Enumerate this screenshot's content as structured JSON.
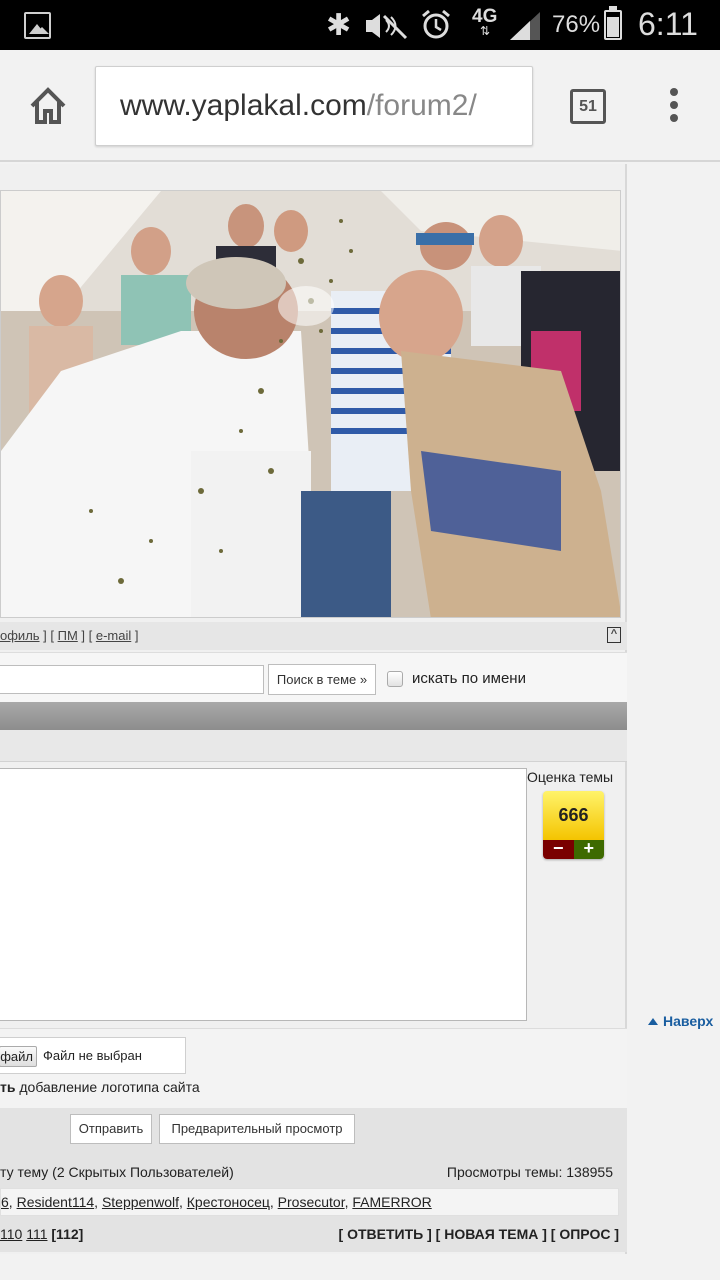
{
  "status_bar": {
    "battery": "76%",
    "time": "6:11",
    "network": "4G",
    "icons": [
      "gallery-icon",
      "bluetooth-icon",
      "mute-icon",
      "alarm-icon",
      "signal-icon",
      "battery-icon"
    ]
  },
  "browser": {
    "url_host": "www.yaplakal.com",
    "url_path": "/forum2/",
    "tab_count": "51"
  },
  "post": {
    "links": {
      "profile": "офиль",
      "pm": "ПМ",
      "email": "e-mail",
      "sep1": " ] [ ",
      "sep2": " ] [ ",
      "end": " ]"
    },
    "top_link": "^"
  },
  "search": {
    "button": "Поиск в теме »",
    "by_name_label": "искать по имени"
  },
  "rating": {
    "label": "Оценка темы",
    "value": "666",
    "minus": "−",
    "plus": "+"
  },
  "upload": {
    "choose_label": "файл",
    "no_file": "Файл не выбран",
    "logo_bold": "ть",
    "logo_text": " добавление логотипа сайта"
  },
  "buttons": {
    "send": "Отправить",
    "preview": "Предварительный просмотр"
  },
  "stats": {
    "readers": "ту тему (2 Скрытых Пользователей)",
    "views": "Просмотры темы: 138955",
    "names": [
      "6",
      "Resident114",
      "Steppenwolf",
      "Крестоносец",
      "Prosecutor",
      "FAMERROR"
    ],
    "pages": [
      "110",
      "111"
    ],
    "current_page": "[112]",
    "actions": "[ ОТВЕТИТЬ ] [ НОВАЯ ТЕМА ] [ ОПРОС ]"
  },
  "nav": {
    "top": "Наверх"
  }
}
